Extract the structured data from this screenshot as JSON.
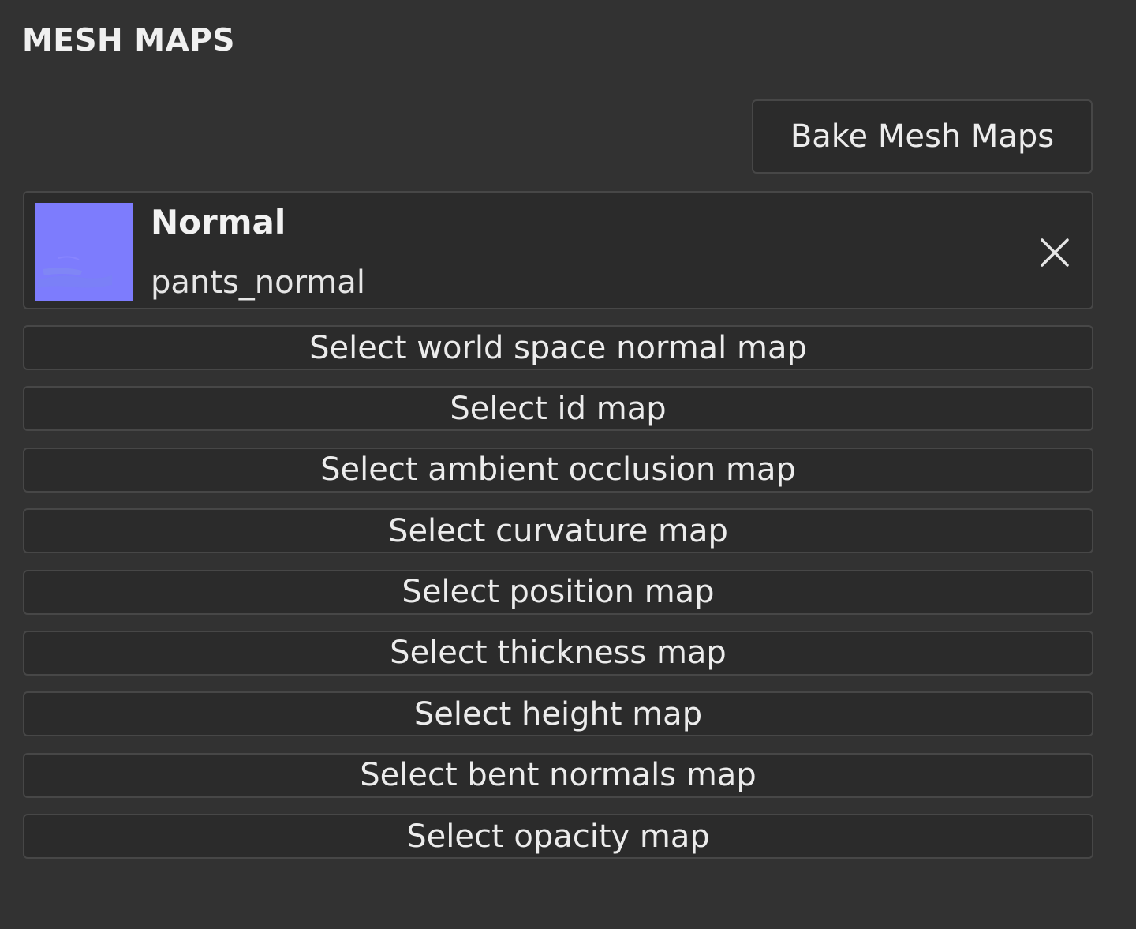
{
  "panel": {
    "title": "MESH MAPS"
  },
  "toolbar": {
    "bake_label": "Bake Mesh Maps"
  },
  "assigned_map": {
    "type_label": "Normal",
    "file_name": "pants_normal",
    "thumbnail_color": "#7d7cfd",
    "remove_icon": "close-icon"
  },
  "select_buttons": [
    {
      "label": "Select world space normal map"
    },
    {
      "label": "Select id map"
    },
    {
      "label": "Select ambient occlusion map"
    },
    {
      "label": "Select curvature map"
    },
    {
      "label": "Select position map"
    },
    {
      "label": "Select thickness map"
    },
    {
      "label": "Select height map"
    },
    {
      "label": "Select bent normals map"
    },
    {
      "label": "Select opacity map"
    }
  ],
  "colors": {
    "background": "#323232",
    "button_background": "#2b2b2b",
    "border": "#474747",
    "text": "#ececec"
  }
}
